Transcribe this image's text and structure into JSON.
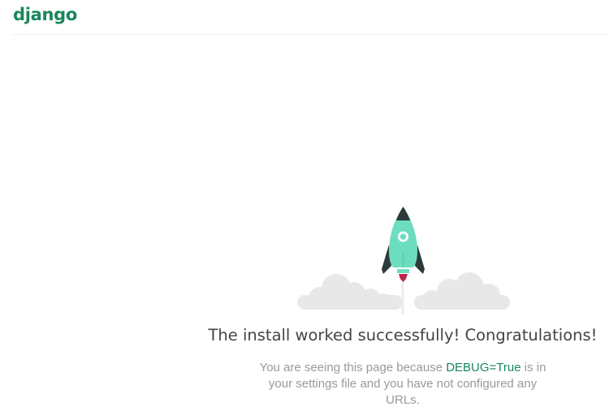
{
  "header": {
    "logo_text": "django"
  },
  "illustration": {
    "icon": "rocket-launch-illustration",
    "colors": {
      "rocket_body": "#6dddc0",
      "rocket_dark": "#2d3a3a",
      "flame": "#c0224c",
      "cloud": "#e8e8e8",
      "trail": "#ececec"
    }
  },
  "main": {
    "headline": "The install worked successfully! Congratulations!",
    "description_before": "You are seeing this page because ",
    "debug_link": "DEBUG=True",
    "description_after": " is in your settings file and you have not configured any URLs."
  },
  "colors": {
    "brand_green": "#19865c",
    "heading_text": "#444444",
    "body_text": "#999999",
    "divider": "#efefef"
  }
}
